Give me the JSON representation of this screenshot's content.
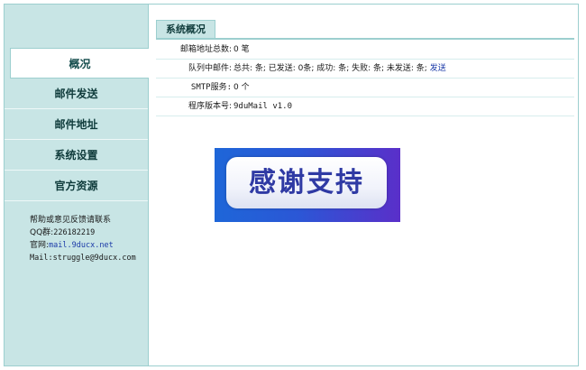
{
  "sidebar": {
    "items": [
      {
        "label": "概况",
        "active": true
      },
      {
        "label": "邮件发送"
      },
      {
        "label": "邮件地址"
      },
      {
        "label": "系统设置"
      },
      {
        "label": "官方资源"
      }
    ],
    "help": {
      "heading": "帮助或意见反馈请联系",
      "qq_label": "QQ群:",
      "qq_value": "226182219",
      "site_label": "官网:",
      "site_value": "mail.9ducx.net",
      "mail_label": "Mail:",
      "mail_value": "struggle@9ducx.com"
    }
  },
  "main": {
    "tab_title": "系统概况",
    "rows": {
      "total_label": "邮箱地址总数:",
      "total_value": "0 笔",
      "queue_label": "队列中邮件:",
      "queue_value": "总共: 条; 已发送: 0条; 成功: 条; 失败: 条; 未发送: 条;",
      "queue_link": "发送",
      "smtp_label": "SMTP服务:",
      "smtp_value": "0 个",
      "version_label": "程序版本号:",
      "version_value": "9duMail v1.0"
    },
    "banner_text": "感谢支持"
  }
}
